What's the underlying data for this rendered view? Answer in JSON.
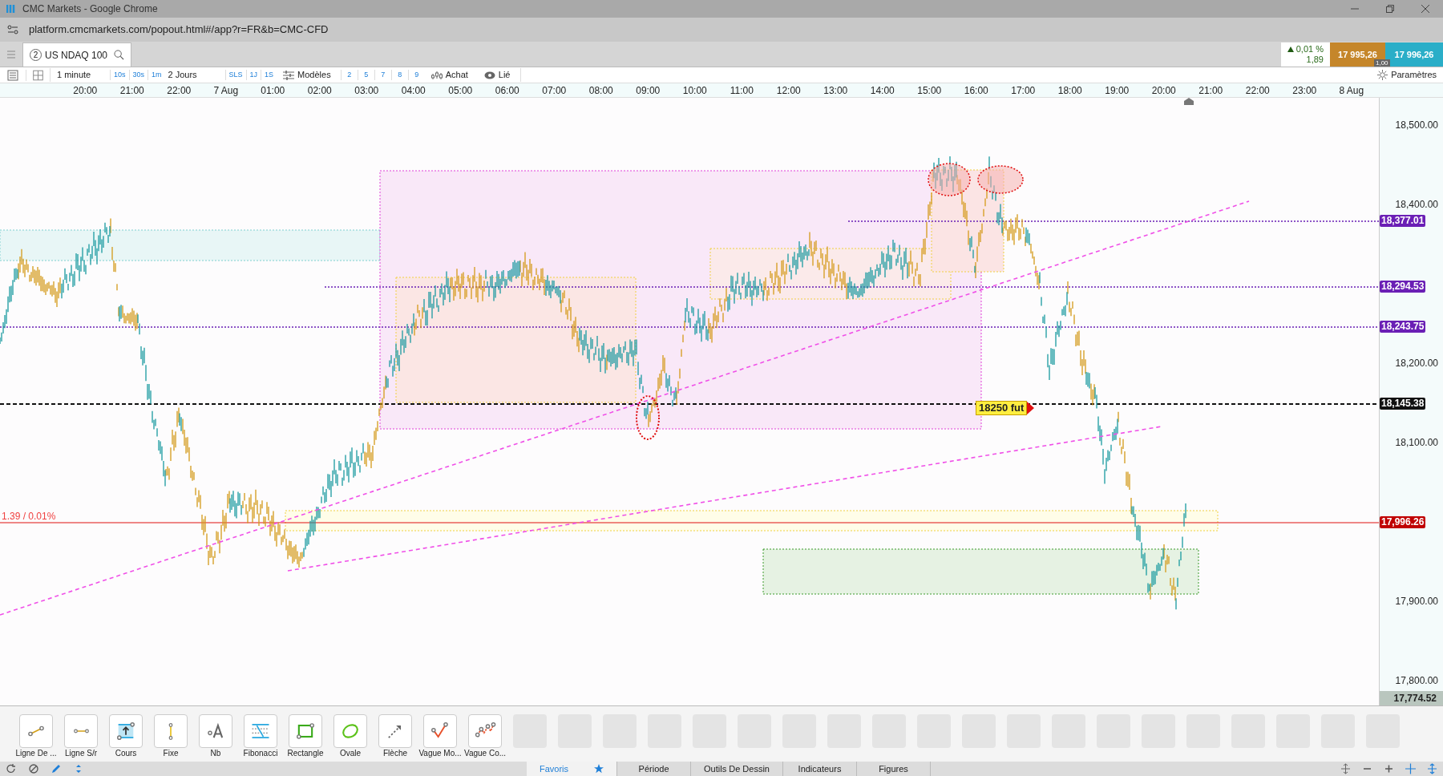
{
  "window": {
    "title": "CMC Markets - Google Chrome"
  },
  "address_bar": {
    "url": "platform.cmcmarkets.com/popout.html#/app?r=FR&b=CMC-CFD"
  },
  "instrument_tab": {
    "count": "2",
    "name": "US NDAQ 100"
  },
  "quote": {
    "change": "0,01 %",
    "change_points": "1,89",
    "sell": "17 995,26",
    "buy": "17 996,26",
    "spread": "1,00"
  },
  "toolbar": {
    "interval": "1 minute",
    "quick_intervals": [
      "10s",
      "30s",
      "1m"
    ],
    "range": "2 Jours",
    "quick_ranges": [
      "SLS",
      "1J",
      "1S"
    ],
    "templates": "Modèles",
    "template_slots": [
      "2",
      "5",
      "7",
      "8",
      "9"
    ],
    "buy": "Achat",
    "linked": "Lié",
    "settings": "Paramètres"
  },
  "time_axis": [
    "20:00",
    "21:00",
    "22:00",
    "7 Aug",
    "01:00",
    "02:00",
    "03:00",
    "04:00",
    "05:00",
    "06:00",
    "07:00",
    "08:00",
    "09:00",
    "10:00",
    "11:00",
    "12:00",
    "13:00",
    "14:00",
    "15:00",
    "16:00",
    "17:00",
    "18:00",
    "19:00",
    "20:00",
    "21:00",
    "22:00",
    "23:00",
    "8 Aug"
  ],
  "price_axis": {
    "ticks": [
      "18,500.00",
      "18,400.00",
      "18,200.00",
      "18,100.00",
      "17,900.00",
      "17,800.00"
    ],
    "markers": [
      {
        "label": "18,377.01",
        "color": "#6a1fb5"
      },
      {
        "label": "18,294.53",
        "color": "#6a1fb5"
      },
      {
        "label": "18,243.75",
        "color": "#6a1fb5"
      },
      {
        "label": "18,145.38",
        "color": "#111111"
      },
      {
        "label": "17,996.26",
        "color": "#c00000"
      }
    ],
    "last_visible": "17,774.52"
  },
  "chart": {
    "level_label": "18250 fut",
    "price_label": "1.39 / 0.01%"
  },
  "drawing_tools": [
    {
      "label": "Ligne De ...",
      "kind": "trendline"
    },
    {
      "label": "Ligne S/r",
      "kind": "hline"
    },
    {
      "label": "Cours",
      "kind": "price"
    },
    {
      "label": "Fixe",
      "kind": "vline"
    },
    {
      "label": "Nb",
      "kind": "text"
    },
    {
      "label": "Fibonacci",
      "kind": "fibonacci"
    },
    {
      "label": "Rectangle",
      "kind": "rectangle"
    },
    {
      "label": "Ovale",
      "kind": "ellipse"
    },
    {
      "label": "Flèche",
      "kind": "arrow"
    },
    {
      "label": "Vague Mo...",
      "kind": "wave"
    },
    {
      "label": "Vague Co...",
      "kind": "wave2"
    }
  ],
  "bottom_tabs": [
    {
      "label": "Favoris",
      "selected": true
    },
    {
      "label": "Période",
      "selected": false
    },
    {
      "label": "Outils De Dessin",
      "selected": false
    },
    {
      "label": "Indicateurs",
      "selected": false
    },
    {
      "label": "Figures",
      "selected": false
    }
  ]
}
